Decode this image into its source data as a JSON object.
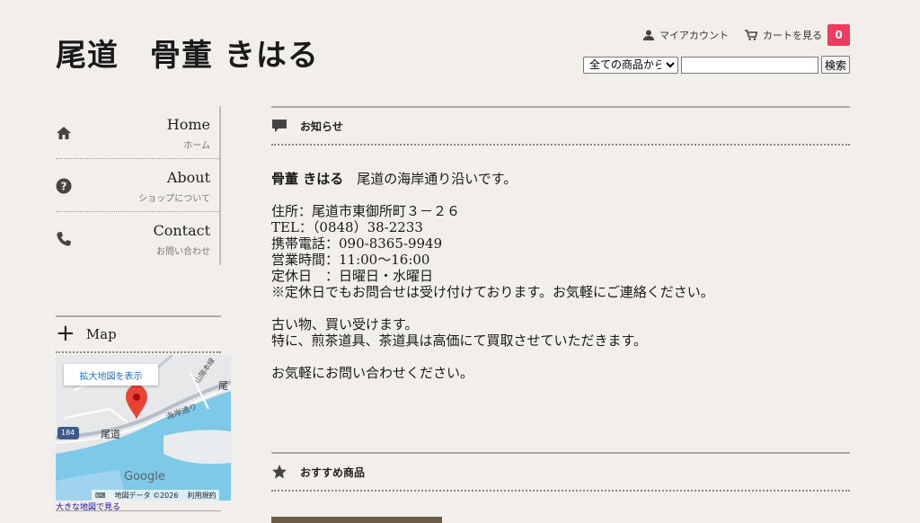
{
  "header": {
    "site_title": "尾道　骨董 きはる",
    "my_account": "マイアカウント",
    "cart_label": "カートを見る",
    "cart_count": "0",
    "search_category": "全ての商品から",
    "search_value": "",
    "search_button": "検索"
  },
  "nav": {
    "items": [
      {
        "en": "Home",
        "ja": "ホーム",
        "icon": "home-icon"
      },
      {
        "en": "About",
        "ja": "ショップについて",
        "icon": "question-icon"
      },
      {
        "en": "Contact",
        "ja": "お問い合わせ",
        "icon": "phone-icon"
      }
    ]
  },
  "map": {
    "label": "Map",
    "enlarge": "拡大地図を表示",
    "footer_data": "地図データ ©2026",
    "footer_terms": "利用規約",
    "link": "大きな地図で見る",
    "places": {
      "onomichi": "尾道",
      "onomichi_right": "尾",
      "coast_road": "海岸通り",
      "sanyo": "山陽本線",
      "route": "184",
      "google": "Google"
    }
  },
  "notice": {
    "title": "お知らせ",
    "shop_name": "骨董 きはる",
    "tagline": "　尾道の海岸通り沿いです。",
    "lines": [
      "住所：尾道市東御所町３－２６",
      "TEL：（0848）38-2233",
      "携帯電話：090-8365-9949",
      "営業時間：11:00～16:00",
      "定休日　：日曜日・水曜日",
      "※定休日でもお問合せは受け付けております。お気軽にご連絡ください。"
    ],
    "buy_lines": [
      "古い物、買い受けます。",
      "特に、煎茶道具、茶道具は高価にて買取させていただきます。"
    ],
    "closing": "お気軽にお問い合わせください。"
  },
  "recommend": {
    "title": "おすすめ商品"
  },
  "colors": {
    "badge": "#f23a5e",
    "background": "#f2efea",
    "sea": "#7ec8e8",
    "pin": "#ea4335"
  }
}
